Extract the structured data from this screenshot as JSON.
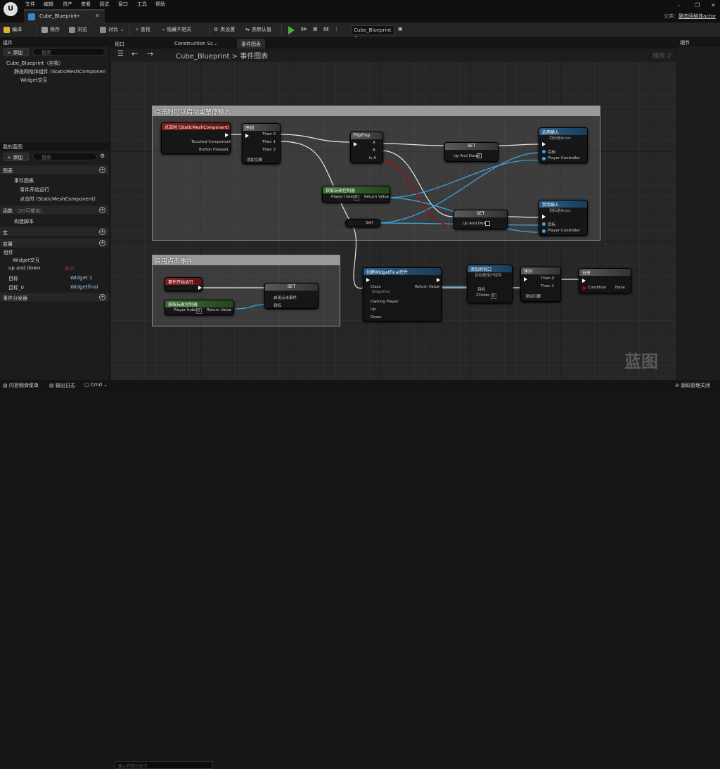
{
  "titlebar": {
    "menus": [
      "文件",
      "编辑",
      "资产",
      "查看",
      "调试",
      "窗口",
      "工具",
      "帮助"
    ],
    "doc_tab": "Cube_Blueprint•",
    "parent_label": "父类：",
    "parent_value": "静态网格体actor"
  },
  "toolbar": {
    "compile": "编译",
    "save": "保存",
    "browse": "浏览",
    "diff": "对比",
    "find": "查找",
    "hide_unrelated": "隐藏不相关",
    "class_settings": "类设置",
    "class_defaults": "类默认值",
    "debug_select": "Cube_Blueprint"
  },
  "components": {
    "title": "组件",
    "add": "添加",
    "search_placeholder": "搜索",
    "root": "Cube_Blueprint（自我）",
    "items": [
      "静态网格体组件 (StaticMeshComponen",
      "Widget交互"
    ]
  },
  "my_blueprint": {
    "title": "我的蓝图",
    "add": "添加",
    "search_placeholder": "搜索",
    "graphs_label": "图表",
    "event_graph": "事件图表",
    "events": [
      "事件开始运行",
      "点击时 (StaticMeshComponent)"
    ],
    "functions_label": "函数",
    "functions_count": "（20可覆盖）",
    "construction": "构造脚本",
    "macros_label": "宏",
    "variables_label": "变量",
    "components_label": "组件",
    "vars": [
      {
        "name": "Widget交互",
        "type": ""
      },
      {
        "name": "up and down",
        "type": "布尔"
      },
      {
        "name": "目标",
        "type": "Widget 1"
      },
      {
        "name": "目标_0",
        "type": "Widgetfinal"
      }
    ],
    "dispatchers_label": "事件分发器"
  },
  "graph": {
    "tabs": [
      "视口",
      "Construction Sc...",
      "事件图表"
    ],
    "breadcrumb_root": "Cube_Blueprint",
    "breadcrumb_leaf": "事件图表",
    "zoom": "缩放-2",
    "watermark": "蓝图"
  },
  "comments": {
    "c1": "点击时可以启动或禁停输入",
    "c2": "启用点击事件"
  },
  "nodes": {
    "onclick": {
      "title": "点击时 (StaticMeshComponent)",
      "p1": "Touched Component",
      "p2": "Button Pressed"
    },
    "seq1": {
      "title": "序列",
      "p1": "Then 0",
      "p2": "Then 1",
      "p3": "Then 2",
      "add": "添加引脚"
    },
    "flipflop": {
      "title": "FlipFlop",
      "a": "A",
      "b": "B",
      "isa": "Is A"
    },
    "set1": {
      "title": "SET",
      "pin": "Up And Down"
    },
    "enable": {
      "title": "启用输入",
      "sub": "目标是Actor",
      "t": "目标",
      "pc": "Player Controller"
    },
    "getpc1": {
      "title": "获取玩家控制器",
      "idx": "Player Index",
      "ret": "Return Value",
      "v": "0"
    },
    "self": {
      "label": "Self"
    },
    "set2": {
      "title": "SET",
      "pin": "Up And Down"
    },
    "disable": {
      "title": "禁用输入",
      "sub": "目标是Actor",
      "t": "目标",
      "pc": "Player Controller"
    },
    "beginplay": {
      "title": "事件开始运行"
    },
    "set3": {
      "title": "SET",
      "pin1": "启用点击事件",
      "pin2": "目标"
    },
    "getpc2": {
      "title": "获取玩家控制器",
      "idx": "Player Index",
      "ret": "Return Value",
      "v": "0"
    },
    "create": {
      "title": "创建WidgetFinal控件",
      "class": "Class",
      "class_val": "Widgetfinal",
      "ret": "Return Value",
      "owner": "Owning Player",
      "up": "Up",
      "down": "Down"
    },
    "addview": {
      "title": "添加到视口",
      "sub": "目标是用户控件",
      "t": "目标",
      "z": "ZOrder",
      "zv": "0"
    },
    "seq2": {
      "title": "序列",
      "p1": "Then 0",
      "p2": "Then 1",
      "add": "添加引脚"
    },
    "branch": {
      "title": "分支",
      "cond": "Condition",
      "f": "False"
    }
  },
  "details": {
    "title": "细节"
  },
  "statusbar": {
    "drawer": "内容侧滑菜单",
    "log": "输出日志",
    "cmd": "Cmd",
    "cmd_placeholder": "输入控制台命令",
    "source_control": "源码管理关闭"
  }
}
